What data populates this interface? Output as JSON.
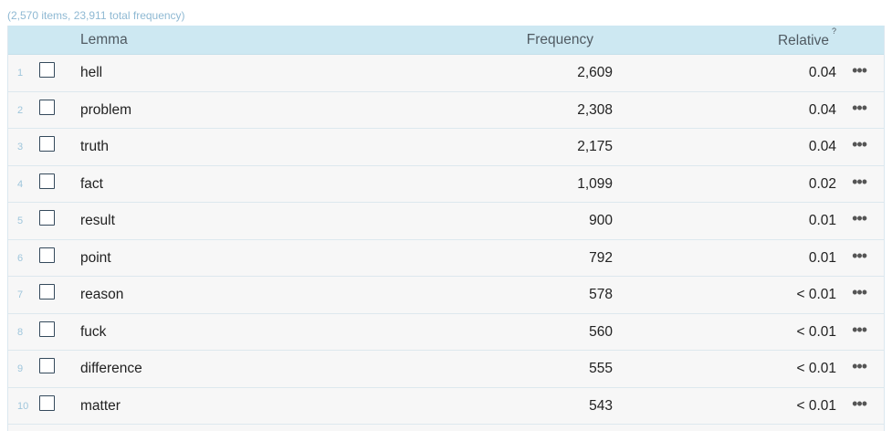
{
  "summary": "(2,570 items, 23,911 total frequency)",
  "columns": {
    "lemma": "Lemma",
    "frequency": "Frequency",
    "relative": "Relative",
    "relative_help": "?"
  },
  "more_icon": "ellipsis-icon",
  "rows": [
    {
      "num": "1",
      "lemma": "hell",
      "frequency": "2,609",
      "relative": "0.04"
    },
    {
      "num": "2",
      "lemma": "problem",
      "frequency": "2,308",
      "relative": "0.04"
    },
    {
      "num": "3",
      "lemma": "truth",
      "frequency": "2,175",
      "relative": "0.04"
    },
    {
      "num": "4",
      "lemma": "fact",
      "frequency": "1,099",
      "relative": "0.02"
    },
    {
      "num": "5",
      "lemma": "result",
      "frequency": "900",
      "relative": "0.01"
    },
    {
      "num": "6",
      "lemma": "point",
      "frequency": "792",
      "relative": "0.01"
    },
    {
      "num": "7",
      "lemma": "reason",
      "frequency": "578",
      "relative": "< 0.01"
    },
    {
      "num": "8",
      "lemma": "fuck",
      "frequency": "560",
      "relative": "< 0.01"
    },
    {
      "num": "9",
      "lemma": "difference",
      "frequency": "555",
      "relative": "< 0.01"
    },
    {
      "num": "10",
      "lemma": "matter",
      "frequency": "543",
      "relative": "< 0.01"
    }
  ]
}
